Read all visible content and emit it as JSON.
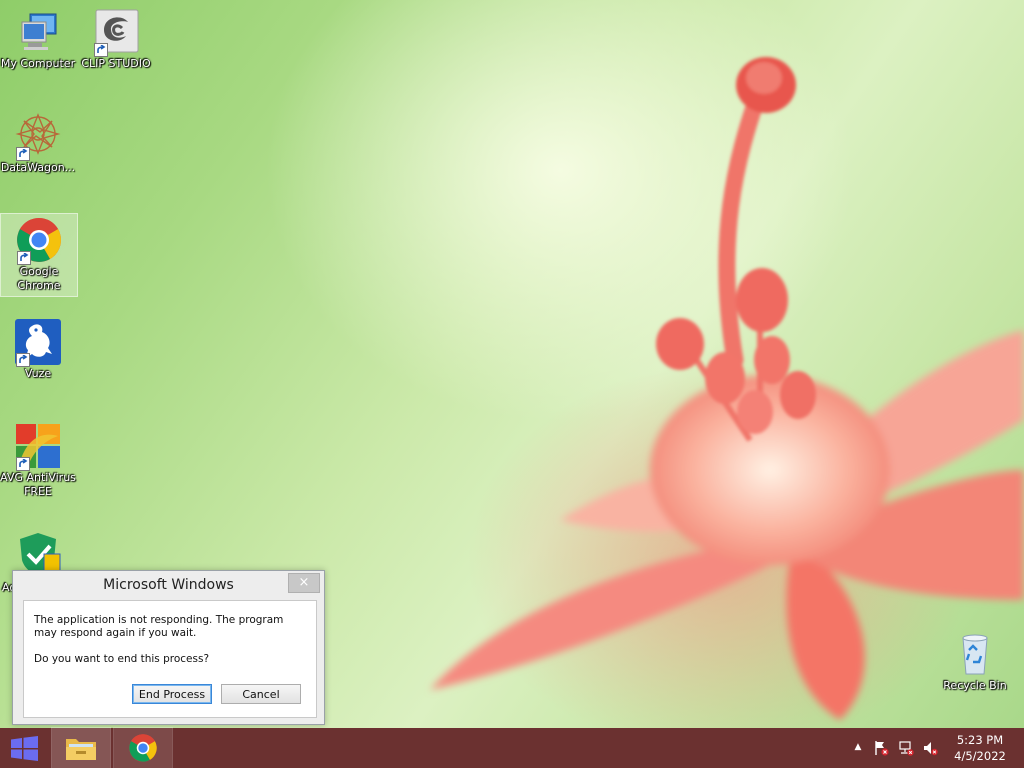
{
  "desktop": {
    "icons": [
      {
        "label": "My Computer"
      },
      {
        "label": "CLIP STUDIO"
      },
      {
        "label": "DataWagon..."
      },
      {
        "label": "Google Chrome"
      },
      {
        "label": "Vuze"
      },
      {
        "label": "AVG AntiVirus FREE"
      },
      {
        "label": "Ad"
      },
      {
        "label": "Recycle Bin"
      }
    ]
  },
  "dialog": {
    "title": "Microsoft Windows",
    "close_glyph": "×",
    "message": "The application is not responding. The program may respond again if you wait.",
    "question": "Do you want to end this process?",
    "end_process_label": "End Process",
    "cancel_label": "Cancel"
  },
  "taskbar": {
    "color": "#6b3130",
    "tray_chevron": "▲",
    "time": "5:23 PM",
    "date": "4/5/2022"
  },
  "colors": {
    "accent": "#3a87d8",
    "alert": "#d6262f"
  }
}
